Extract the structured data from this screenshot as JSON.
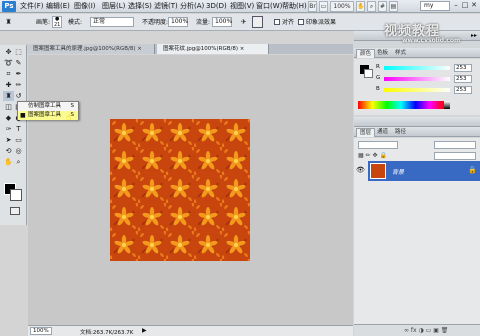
{
  "app": {
    "logo": "Ps"
  },
  "menu": {
    "items": [
      "文件(F)",
      "编辑(E)",
      "图像(I)",
      "图层(L)",
      "选择(S)",
      "滤镜(T)",
      "分析(A)",
      "3D(D)",
      "视图(V)",
      "窗口(W)",
      "帮助(H)"
    ]
  },
  "titlebar": {
    "zoom": "100%",
    "workspace": "my",
    "minimize": "–",
    "restore": "□",
    "close": "✕"
  },
  "options": {
    "brush_label": "画笔:",
    "brush_size": "21",
    "mode_label": "模式:",
    "mode_value": "正常",
    "opacity_label": "不透明度:",
    "opacity_value": "100%",
    "flow_label": "流量:",
    "flow_value": "100%",
    "align_label": "对齐",
    "impressionist_label": "印象派效果"
  },
  "tabs": [
    {
      "label": "图案图案工具的原理.jpg@100%(RGB/8)  ×",
      "active": false
    },
    {
      "label": "图案花纹.jpg@100%(RGB/8)  ×",
      "active": true
    }
  ],
  "flyout": {
    "items": [
      {
        "label": "仿制图章工具",
        "key": "S",
        "selected": false
      },
      {
        "label": "图案图章工具",
        "key": "S",
        "selected": true
      }
    ]
  },
  "status": {
    "zoom": "100%",
    "doc_info": "文档:263.7K/263.7K"
  },
  "color_panel": {
    "tabs": [
      "颜色",
      "色板",
      "样式"
    ],
    "r_label": "R",
    "g_label": "G",
    "b_label": "B",
    "r_value": "253",
    "g_value": "253",
    "b_value": "253"
  },
  "layers_panel": {
    "tabs": [
      "图层",
      "通道",
      "路径"
    ],
    "layer_name": "背景"
  },
  "watermark": {
    "line1": "视频教程",
    "line2": "www.cvsolid.com"
  },
  "colors": {
    "accent": "#3869c3",
    "pattern": "#c8460e",
    "highlight": "#fbfb8f"
  }
}
